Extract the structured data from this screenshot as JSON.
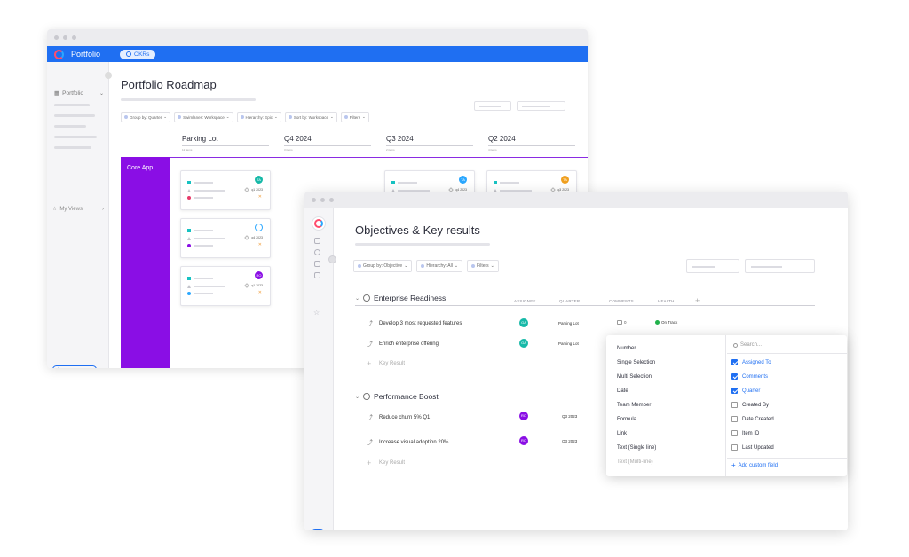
{
  "back_window": {
    "app_title": "Portfolio",
    "okr_pill": "OKRs",
    "sidebar": {
      "header": "Portfolio",
      "my_views": "My Views",
      "add_button": "+"
    },
    "page_title": "Portfolio Roadmap",
    "filters": [
      "Group by: Quarter",
      "Swimlanes: Workspace",
      "Hierarchy: Epic",
      "Sort by: Workspace",
      "Filters"
    ],
    "columns": [
      {
        "title": "Parking Lot",
        "sub": "12 items"
      },
      {
        "title": "Q4 2024",
        "sub": "3 items"
      },
      {
        "title": "Q3 2024",
        "sub": "2 items"
      },
      {
        "title": "Q2 2024",
        "sub": "4 items"
      }
    ],
    "swimlane": "Core App",
    "cards": [
      {
        "avatar": "TA",
        "avatar_color": "#17b9a8",
        "quarter": "q1 2023"
      },
      {
        "avatar": "",
        "avatar_color": "#ffffff",
        "quarter": "q4 2023"
      },
      {
        "avatar": "RO",
        "avatar_color": "#8a0ee5",
        "quarter": "q1 2023"
      },
      {
        "avatar": "TA",
        "avatar_color": "#2aa7ff",
        "quarter": "q4 2023"
      },
      {
        "avatar": "TA",
        "avatar_color": "#f0a020",
        "quarter": "q3 2023"
      }
    ]
  },
  "front_window": {
    "page_title": "Objectives & Key results",
    "filters": [
      "Group by: Objective",
      "Hierarchy: All",
      "Filters"
    ],
    "columns": {
      "assignee": "ASSIGNEE",
      "quarter": "QUARTER",
      "comments": "COMMENTS",
      "health": "HEALTH",
      "add": "+"
    },
    "groups": [
      {
        "title": "Enterprise Readiness",
        "rows": [
          {
            "title": "Develop 3 most requested features",
            "assignee": "GA",
            "assignee_color": "#17b9a8",
            "quarter": "Parking Lot",
            "comments": "0",
            "health": "On Track"
          },
          {
            "title": "Enrich enterprise offering",
            "assignee": "GA",
            "assignee_color": "#17b9a8",
            "quarter": "Parking Lot"
          }
        ],
        "add_label": "Key Result"
      },
      {
        "title": "Performance Boost",
        "rows": [
          {
            "title": "Reduce churn 5% Q1",
            "assignee": "RO",
            "assignee_color": "#8a0ee5",
            "quarter": "Q3 2023"
          },
          {
            "title": "Increase visual adoption 20%",
            "assignee": "RO",
            "assignee_color": "#8a0ee5",
            "quarter": "Q3 2023"
          }
        ],
        "add_label": "Key Result"
      }
    ],
    "sidebar_add": "+"
  },
  "field_dropdown": {
    "field_types": [
      "Number",
      "Single Selection",
      "Multi Selection",
      "Date",
      "Team Member",
      "Formula",
      "Link",
      "Text (Single line)",
      "Text (Multi-line)"
    ],
    "search_placeholder": "Search...",
    "fields": [
      {
        "label": "Assigned To",
        "checked": true
      },
      {
        "label": "Comments",
        "checked": true
      },
      {
        "label": "Quarter",
        "checked": true
      },
      {
        "label": "Created By",
        "checked": false
      },
      {
        "label": "Date Created",
        "checked": false
      },
      {
        "label": "Item ID",
        "checked": false
      },
      {
        "label": "Last Updated",
        "checked": false
      }
    ],
    "add_custom_field": "Add custom field"
  }
}
